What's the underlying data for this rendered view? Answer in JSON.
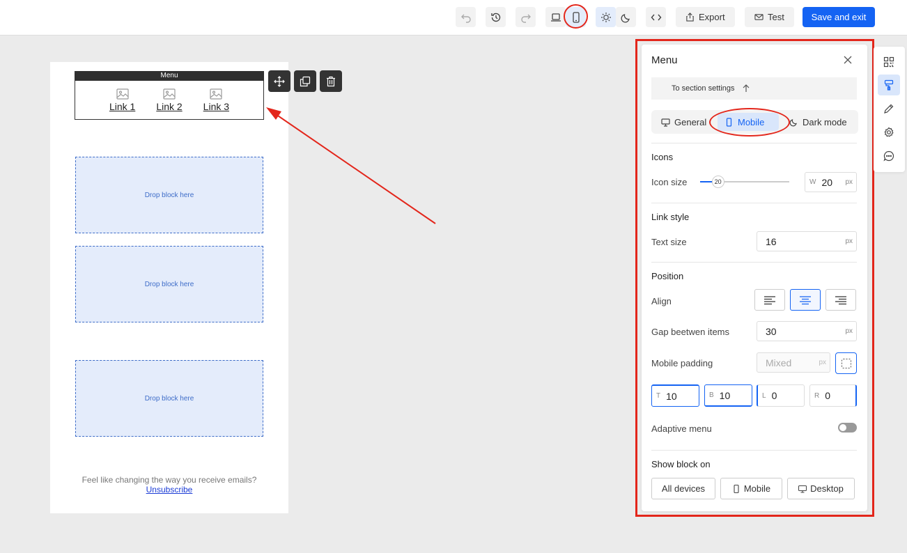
{
  "toolbar": {
    "undo_icon": "undo-icon",
    "history_icon": "history-icon",
    "redo_icon": "redo-icon",
    "desktop_icon": "laptop-icon",
    "mobile_icon": "mobile-icon",
    "light_icon": "sun-icon",
    "dark_icon": "moon-icon",
    "code_icon": "code-icon",
    "export_label": "Export",
    "test_label": "Test",
    "save_label": "Save and exit",
    "accent": "#1463f3",
    "annotation_color": "#e3261b"
  },
  "email": {
    "menu_tag": "Menu",
    "links": [
      {
        "label": "Link 1",
        "icon": "image-icon"
      },
      {
        "label": "Link 2",
        "icon": "image-icon"
      },
      {
        "label": "Link 3",
        "icon": "image-icon"
      }
    ],
    "drop_label_1": "Drop block here",
    "drop_label_2": "Drop block here",
    "drop_label_3": "Drop block here",
    "footer_text": "Feel like changing the way you receive emails?",
    "footer_link": "Unsubscribe"
  },
  "panel": {
    "title": "Menu",
    "to_section": "To section settings",
    "tabs": {
      "general": "General",
      "mobile": "Mobile",
      "dark": "Dark mode"
    },
    "icons_title": "Icons",
    "icon_size_label": "Icon size",
    "icon_size_slider": "20",
    "icon_w_prefix": "W",
    "icon_w_value": "20",
    "unit": "px",
    "link_style_title": "Link style",
    "text_size_label": "Text size",
    "text_size_value": "16",
    "position_title": "Position",
    "align_label": "Align",
    "align_selected": "center",
    "gap_label": "Gap beetwen items",
    "gap_value": "30",
    "mobile_padding_label": "Mobile padding",
    "mobile_padding_placeholder": "Mixed",
    "padding": {
      "t_prefix": "T",
      "t": "10",
      "b_prefix": "B",
      "b": "10",
      "l_prefix": "L",
      "l": "0",
      "r_prefix": "R",
      "r": "0"
    },
    "adaptive_label": "Adaptive menu",
    "adaptive_on": false,
    "show_block_title": "Show block on",
    "devices": {
      "all": "All devices",
      "mobile": "Mobile",
      "desktop": "Desktop"
    }
  }
}
